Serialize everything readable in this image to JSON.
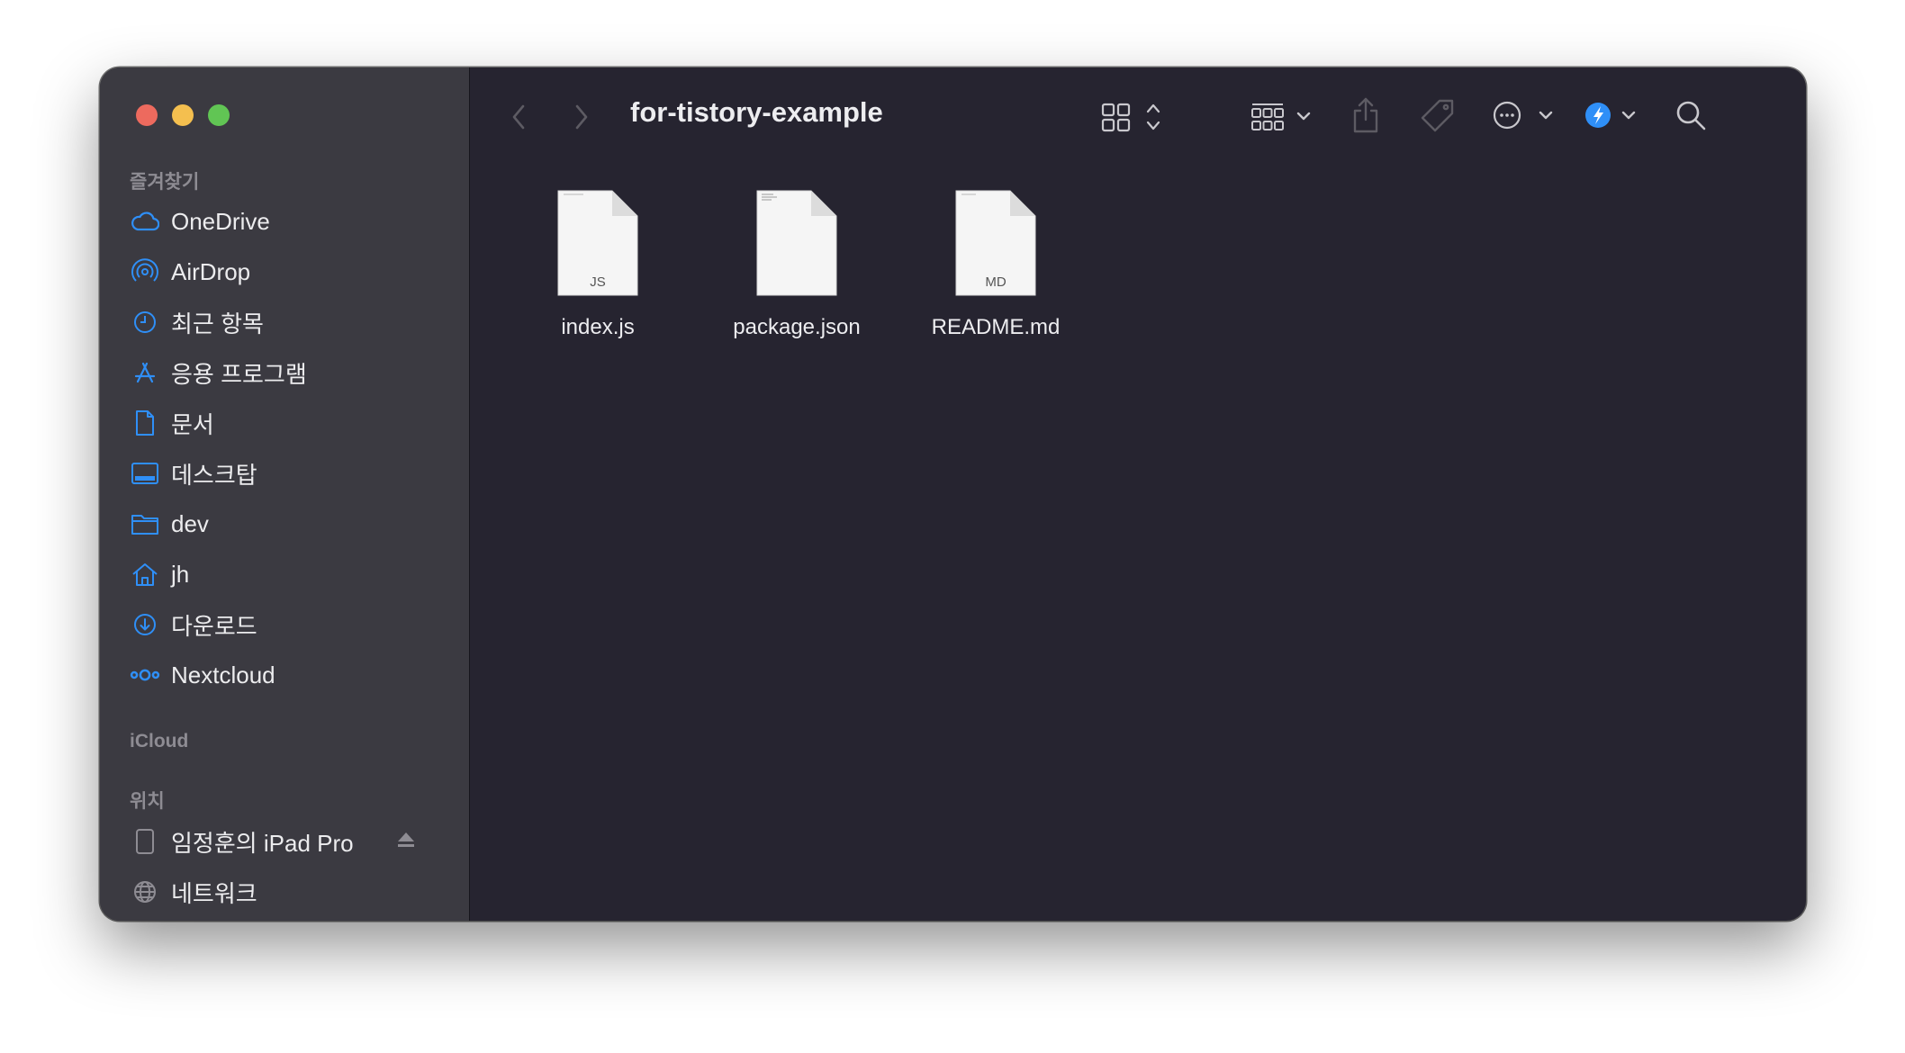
{
  "window": {
    "title": "for-tistory-example"
  },
  "sidebar": {
    "sections": {
      "favorites": "즐겨찾기",
      "icloud": "iCloud",
      "locations": "위치"
    },
    "favorites": [
      {
        "label": "OneDrive",
        "icon": "cloud-icon"
      },
      {
        "label": "AirDrop",
        "icon": "airdrop-icon"
      },
      {
        "label": "최근 항목",
        "icon": "clock-icon"
      },
      {
        "label": "응용 프로그램",
        "icon": "applications-icon"
      },
      {
        "label": "문서",
        "icon": "document-icon"
      },
      {
        "label": "데스크탑",
        "icon": "desktop-icon"
      },
      {
        "label": "dev",
        "icon": "folder-icon"
      },
      {
        "label": "jh",
        "icon": "home-icon"
      },
      {
        "label": "다운로드",
        "icon": "download-icon"
      },
      {
        "label": "Nextcloud",
        "icon": "nextcloud-icon"
      }
    ],
    "locations": [
      {
        "label": "임정훈의 iPad Pro",
        "icon": "ipad-icon"
      },
      {
        "label": "네트워크",
        "icon": "network-icon"
      }
    ]
  },
  "files": [
    {
      "name": "index.js",
      "badge": "JS"
    },
    {
      "name": "package.json",
      "badge": ""
    },
    {
      "name": "README.md",
      "badge": "MD"
    }
  ],
  "colors": {
    "accent": "#2f8ff7",
    "sidebar_bg": "#3b3a41",
    "content_bg": "#262430",
    "close": "#ed6a5e",
    "minimize": "#f4bf4f",
    "zoom": "#61c554"
  }
}
